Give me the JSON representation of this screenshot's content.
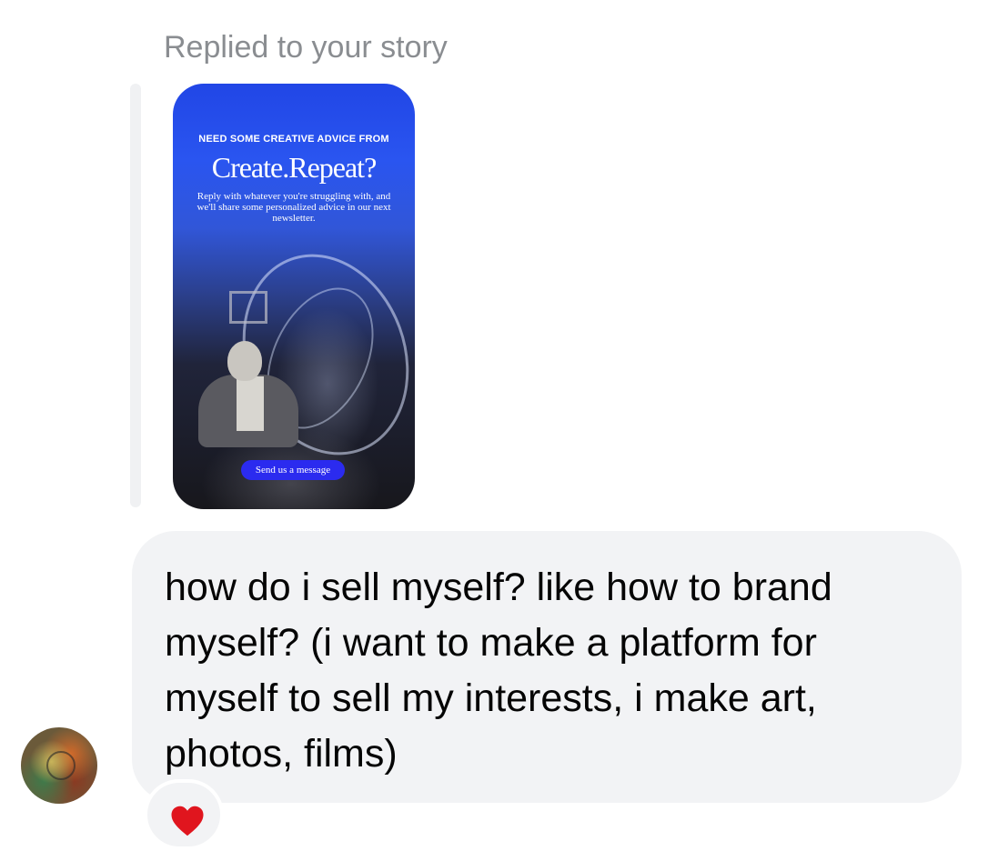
{
  "header": {
    "replied_label": "Replied to your story"
  },
  "story": {
    "eyebrow": "NEED SOME CREATIVE ADVICE FROM",
    "title": "Create.Repeat?",
    "body": "Reply with whatever you're struggling with, and we'll share some personalized advice in our next newsletter.",
    "cta_label": "Send us a message",
    "accent_color": "#2b2bef"
  },
  "message": {
    "text": "how do i sell myself? like how to brand myself? (i want to make a platform for myself to sell my interests, i make art, photos, films)"
  },
  "sender": {
    "avatar_icon": "profile-avatar"
  },
  "reaction": {
    "emoji_icon": "heart-icon",
    "color": "#e0151e"
  }
}
